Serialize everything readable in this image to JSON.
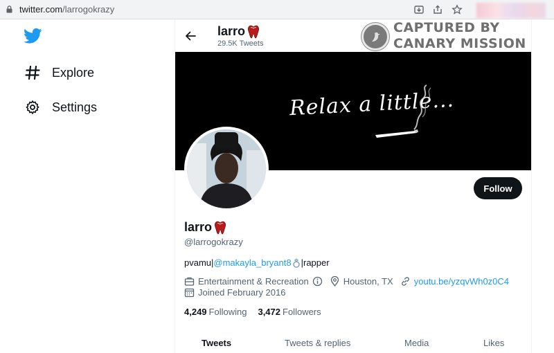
{
  "browser": {
    "url_host": "twitter.com",
    "url_path": "/larrogokrazy",
    "icons": [
      "lock-icon",
      "install-icon",
      "share-icon",
      "bookmark-star-icon"
    ]
  },
  "nav": {
    "logo": "twitter-bird-icon",
    "items": [
      {
        "label": "Explore",
        "icon": "hashtag-icon"
      },
      {
        "label": "Settings",
        "icon": "gear-icon"
      }
    ]
  },
  "header": {
    "name": "larro",
    "tweet_count": "29.5K Tweets"
  },
  "watermark": {
    "line1": "CAPTURED BY",
    "line2": "CANARY MISSION"
  },
  "banner": {
    "text": "Relax a little..."
  },
  "profile": {
    "name": "larro",
    "handle": "@larrogokrazy",
    "follow_label": "Follow",
    "bio_prefix": "pvamu|",
    "bio_mention": "@makayla_bryant8",
    "bio_suffix": "|rapper",
    "category": "Entertainment & Recreation",
    "location": "Houston, TX",
    "website": "youtu.be/yzqvWh0z0C4",
    "joined": "Joined February 2016",
    "following_count": "4,249",
    "following_label": "Following",
    "followers_count": "3,472",
    "followers_label": "Followers"
  },
  "tabs": [
    "Tweets",
    "Tweets & replies",
    "Media",
    "Likes"
  ],
  "colors": {
    "accent": "#1d9bf0",
    "text_primary": "#0f1419",
    "text_secondary": "#536471",
    "button_dark": "#0f1419"
  }
}
